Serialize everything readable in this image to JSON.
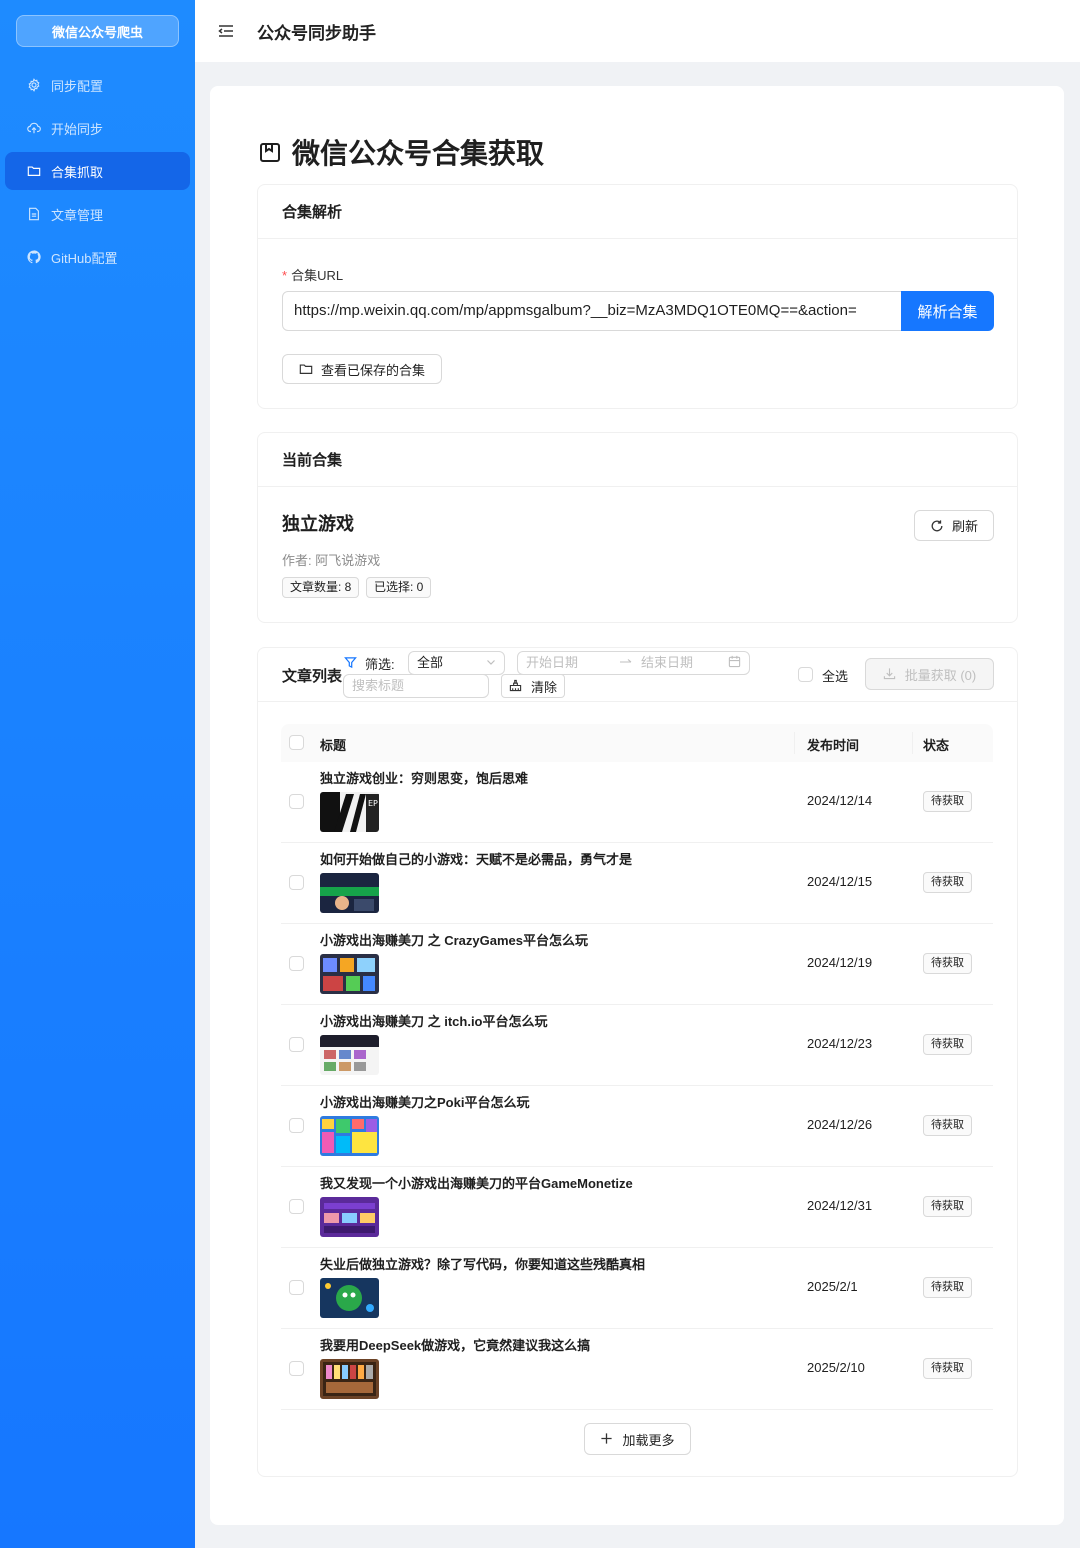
{
  "sidebar": {
    "brand": "微信公众号爬虫",
    "items": [
      {
        "label": "同步配置",
        "icon": "gear-icon"
      },
      {
        "label": "开始同步",
        "icon": "cloud-upload-icon"
      },
      {
        "label": "合集抓取",
        "icon": "folder-icon"
      },
      {
        "label": "文章管理",
        "icon": "file-icon"
      },
      {
        "label": "GitHub配置",
        "icon": "github-icon"
      }
    ],
    "active_index": 2
  },
  "header": {
    "title": "公众号同步助手"
  },
  "page": {
    "title": "微信公众号合集获取"
  },
  "parse_card": {
    "title": "合集解析",
    "url_label": "合集URL",
    "url_value": "https://mp.weixin.qq.com/mp/appmsgalbum?__biz=MzA3MDQ1OTE0MQ==&action=",
    "parse_button": "解析合集",
    "saved_button": "查看已保存的合集"
  },
  "current_card": {
    "title": "当前合集",
    "name": "独立游戏",
    "author": "作者: 阿飞说游戏",
    "count_tag": "文章数量: 8",
    "selected_tag": "已选择: 0",
    "refresh_button": "刷新"
  },
  "list_card": {
    "title": "文章列表",
    "filter_label": "筛选:",
    "filter_value": "全部",
    "start_date_placeholder": "开始日期",
    "end_date_placeholder": "结束日期",
    "search_placeholder": "搜索标题",
    "clear_button": "清除",
    "select_all": "全选",
    "batch_button": "批量获取 (0)",
    "columns": {
      "title": "标题",
      "date": "发布时间",
      "status": "状态"
    },
    "load_more": "加载更多",
    "rows": [
      {
        "title": "独立游戏创业：穷则思变，饱后思难",
        "date": "2024/12/14",
        "status": "待获取"
      },
      {
        "title": "如何开始做自己的小游戏：天赋不是必需品，勇气才是",
        "date": "2024/12/15",
        "status": "待获取"
      },
      {
        "title": "小游戏出海赚美刀 之 CrazyGames平台怎么玩",
        "date": "2024/12/19",
        "status": "待获取"
      },
      {
        "title": "小游戏出海赚美刀 之 itch.io平台怎么玩",
        "date": "2024/12/23",
        "status": "待获取"
      },
      {
        "title": "小游戏出海赚美刀之Poki平台怎么玩",
        "date": "2024/12/26",
        "status": "待获取"
      },
      {
        "title": "我又发现一个小游戏出海赚美刀的平台GameMonetize",
        "date": "2024/12/31",
        "status": "待获取"
      },
      {
        "title": "失业后做独立游戏？除了写代码，你要知道这些残酷真相",
        "date": "2025/2/1",
        "status": "待获取"
      },
      {
        "title": "我要用DeepSeek做游戏，它竟然建议我这么搞",
        "date": "2025/2/10",
        "status": "待获取"
      }
    ]
  },
  "colors": {
    "primary": "#1677ff",
    "sidebar": "#1e8bff",
    "danger": "#ff4d4f"
  }
}
